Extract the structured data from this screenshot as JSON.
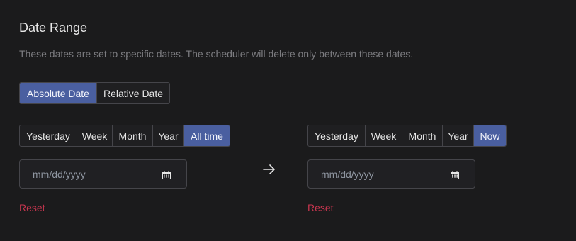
{
  "section": {
    "title": "Date Range",
    "description": "These dates are set to specific dates. The scheduler will delete only between these dates."
  },
  "mode": {
    "options": [
      "Absolute Date",
      "Relative Date"
    ],
    "selected": "Absolute Date"
  },
  "start": {
    "presets": [
      "Yesterday",
      "Week",
      "Month",
      "Year",
      "All time"
    ],
    "selected": "All time",
    "placeholder": "mm/dd/yyyy",
    "value": "",
    "icon": "calendar-icon",
    "reset_label": "Reset"
  },
  "end": {
    "presets": [
      "Yesterday",
      "Week",
      "Month",
      "Year",
      "Now"
    ],
    "selected": "Now",
    "placeholder": "mm/dd/yyyy",
    "value": "",
    "icon": "calendar-icon",
    "reset_label": "Reset"
  },
  "separator_icon": "arrow-right-icon",
  "colors": {
    "background": "#1b1b1c",
    "accent": "#4a5fa0",
    "danger": "#c8364f",
    "muted_text": "#7c7c80",
    "border": "#45454a"
  }
}
